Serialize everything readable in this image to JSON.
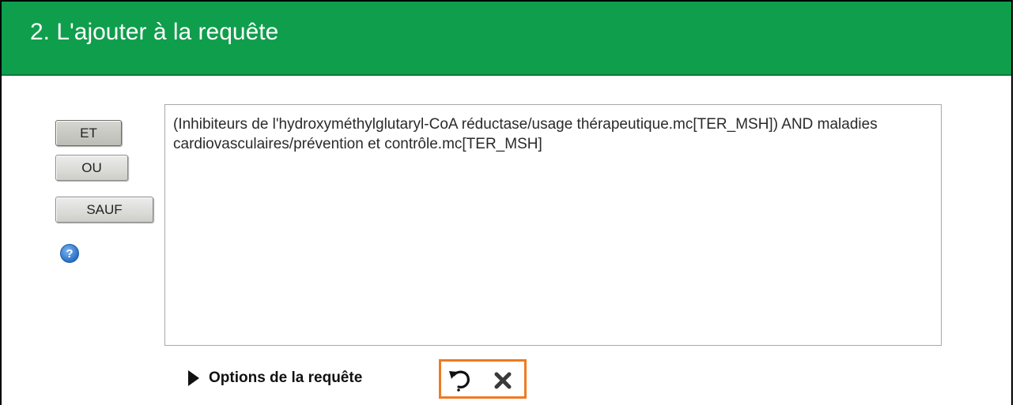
{
  "header": {
    "title": "2. L'ajouter à la requête"
  },
  "operators": [
    {
      "label": "ET",
      "active": true
    },
    {
      "label": "OU",
      "active": false
    },
    {
      "label": "SAUF",
      "active": false
    }
  ],
  "help": {
    "icon": "help-icon",
    "glyph": "?"
  },
  "query": {
    "text": "(Inhibiteurs de l'hydroxyméthylglutaryl-CoA réductase/usage thérapeutique.mc[TER_MSH]) AND maladies cardiovasculaires/prévention et contrôle.mc[TER_MSH]"
  },
  "options": {
    "label": "Options de la requête",
    "expand_icon": "triangle-right-icon",
    "undo_icon": "undo-icon",
    "clear_icon": "clear-icon",
    "highlight_color": "#f07a22"
  },
  "colors": {
    "header_bg": "#0f9e4c",
    "header_text": "#ffffff"
  }
}
